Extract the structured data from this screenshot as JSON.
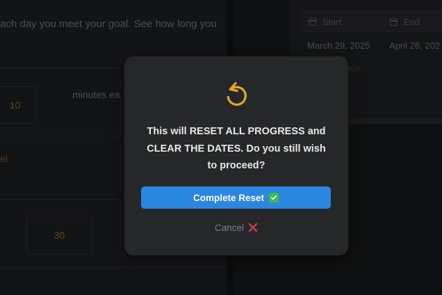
{
  "background": {
    "description_text": "ach day you meet your goal. See how long you",
    "goal_input_value": "10",
    "minutes_label": "minutes ea",
    "orange_label": "el",
    "second_input_value": "30",
    "table": {
      "start_header": "Start",
      "end_header": "End",
      "start_date": "March 29, 2025",
      "end_date": "April 26, 202",
      "muted_text": "age"
    }
  },
  "modal": {
    "icon": "reset-arrow-icon",
    "message": "This will RESET ALL PROGRESS and\nCLEAR THE DATES. Do you still wish\nto proceed?",
    "confirm_label": "Complete Reset",
    "confirm_icon": "check-mark-icon",
    "cancel_label": "Cancel",
    "cancel_icon": "cross-mark-icon"
  },
  "colors": {
    "accent": "#2b86e0",
    "icon_orange": "#e5a72a",
    "check_green": "#3fb950",
    "cross_red": "#d23a4e",
    "modal_bg": "#262728"
  }
}
